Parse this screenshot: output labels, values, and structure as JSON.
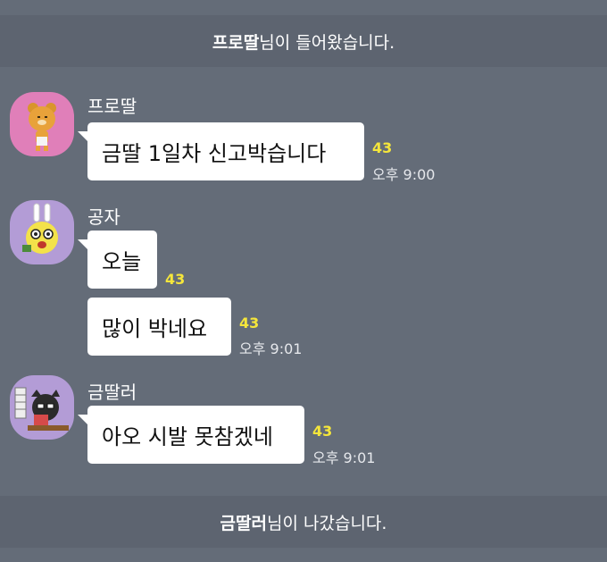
{
  "notices": {
    "join": {
      "nickname": "프로딸",
      "suffix": "님이 들어왔습니다."
    },
    "leave": {
      "nickname": "금딸러",
      "suffix": "님이 나갔습니다."
    }
  },
  "messages": [
    {
      "sender": "프로딸",
      "avatar": "ryan-icon",
      "bubbles": [
        {
          "text": "금딸 1일차 신고박습니다",
          "unread": "43",
          "time": "오후 9:00"
        }
      ]
    },
    {
      "sender": "공자",
      "avatar": "muzi-icon",
      "bubbles": [
        {
          "text": "오늘",
          "unread": "43",
          "time": ""
        },
        {
          "text": "많이 박네요",
          "unread": "43",
          "time": "오후 9:01"
        }
      ]
    },
    {
      "sender": "금딸러",
      "avatar": "neo-icon",
      "bubbles": [
        {
          "text": "아오 시발 못참겠네",
          "unread": "43",
          "time": "오후 9:01"
        }
      ]
    }
  ],
  "colors": {
    "background": "#646c78",
    "notice_band": "#5d6470",
    "bubble": "#ffffff",
    "unread_count": "#f5e63b"
  }
}
